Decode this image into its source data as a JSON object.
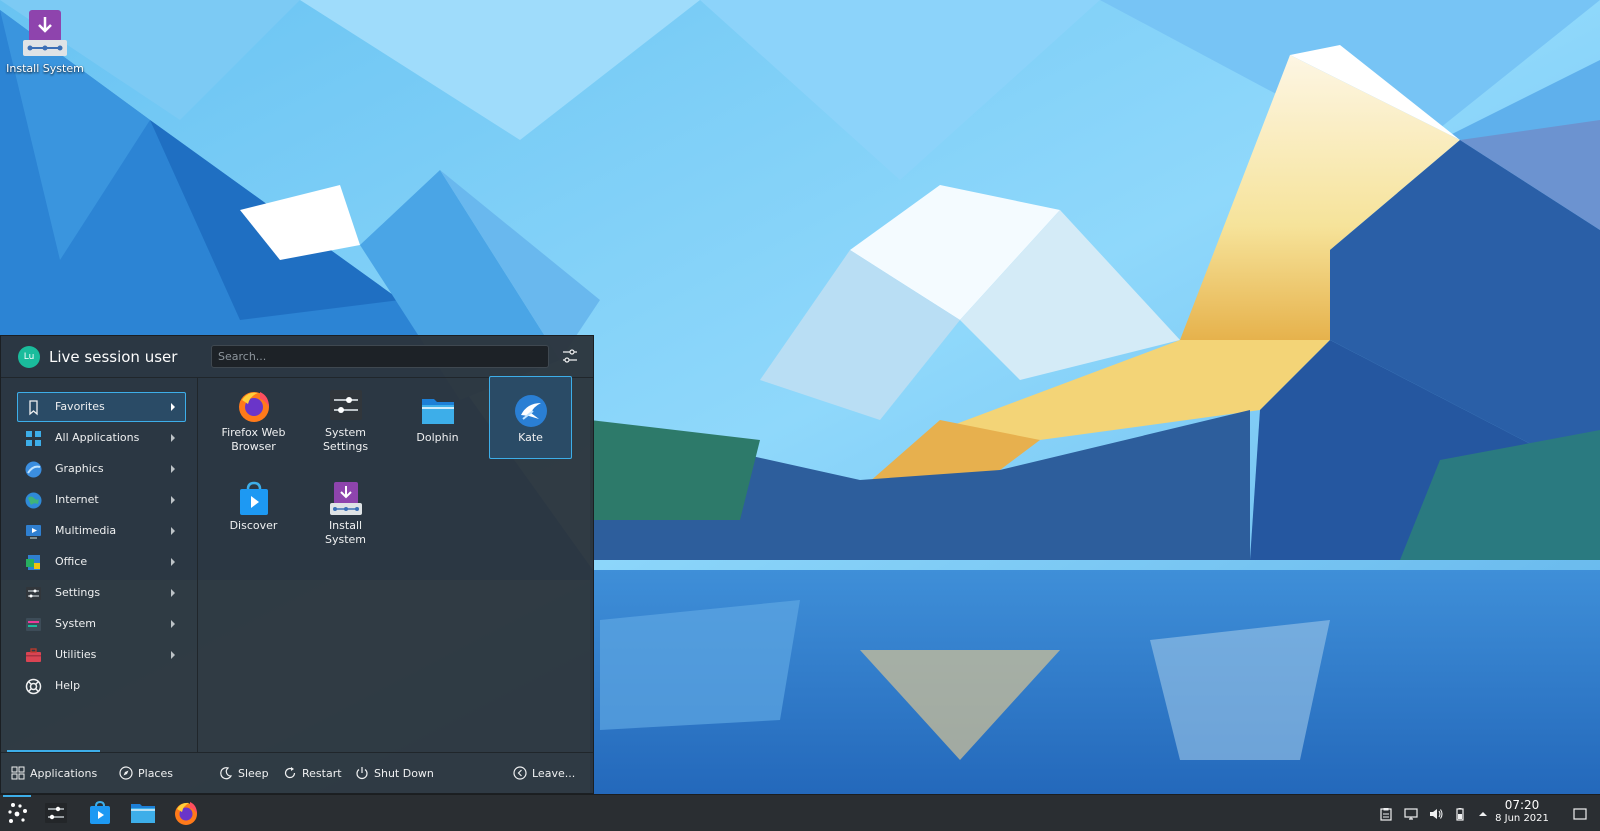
{
  "desktop": {
    "icons": [
      {
        "label": "Install System",
        "icon": "install-system-icon"
      }
    ]
  },
  "launcher": {
    "user": {
      "name": "Live session user",
      "initials": "Lu"
    },
    "search": {
      "placeholder": "Search...",
      "value": ""
    },
    "categories": [
      {
        "label": "Favorites",
        "icon": "bookmark-icon",
        "active": true
      },
      {
        "label": "All Applications",
        "icon": "grid-icon"
      },
      {
        "label": "Graphics",
        "icon": "graphics-icon"
      },
      {
        "label": "Internet",
        "icon": "globe-icon"
      },
      {
        "label": "Multimedia",
        "icon": "multimedia-icon"
      },
      {
        "label": "Office",
        "icon": "office-icon"
      },
      {
        "label": "Settings",
        "icon": "settings-icon"
      },
      {
        "label": "System",
        "icon": "system-icon"
      },
      {
        "label": "Utilities",
        "icon": "toolbox-icon"
      },
      {
        "label": "Help",
        "icon": "help-icon"
      }
    ],
    "favorites": [
      {
        "label": "Firefox Web Browser",
        "icon": "firefox-icon"
      },
      {
        "label": "System Settings",
        "icon": "system-settings-icon"
      },
      {
        "label": "Dolphin",
        "icon": "folder-icon"
      },
      {
        "label": "Kate",
        "icon": "kate-icon",
        "active": true
      },
      {
        "label": "Discover",
        "icon": "discover-icon"
      },
      {
        "label": "Install System",
        "icon": "install-system-icon"
      }
    ],
    "footer": {
      "tabs": [
        {
          "label": "Applications",
          "active": true
        },
        {
          "label": "Places"
        }
      ],
      "actions": [
        {
          "label": "Sleep"
        },
        {
          "label": "Restart"
        },
        {
          "label": "Shut Down"
        }
      ],
      "leave": "Leave..."
    }
  },
  "taskbar": {
    "tasks": [
      "application-launcher-icon",
      "system-settings-icon",
      "discover-icon",
      "dolphin-icon",
      "firefox-icon"
    ],
    "tray": [
      "clipboard-icon",
      "network-icon",
      "volume-icon",
      "battery-icon",
      "expand-tray-icon"
    ],
    "clock": {
      "time": "07:20",
      "date": "8 Jun 2021"
    }
  },
  "colors": {
    "accent": "#3daee9",
    "panel": "#2a2e32",
    "launcher_bg": "#2c343c"
  }
}
